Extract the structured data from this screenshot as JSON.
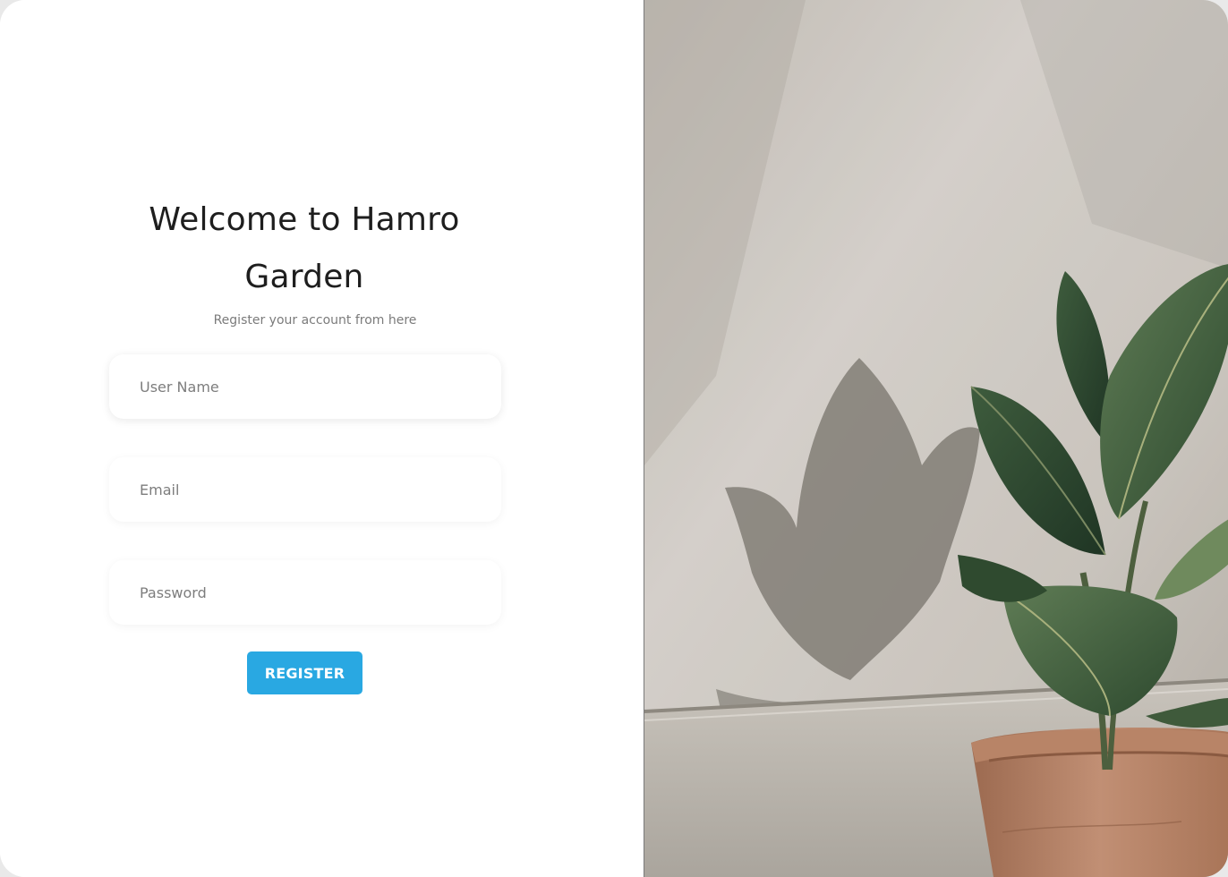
{
  "header": {
    "title": "Welcome to Hamro Garden",
    "subtitle": "Register your account from here"
  },
  "form": {
    "username": {
      "placeholder": "User Name",
      "value": ""
    },
    "email": {
      "placeholder": "Email",
      "value": ""
    },
    "password": {
      "placeholder": "Password",
      "value": ""
    },
    "submit_label": "REGISTER"
  },
  "colors": {
    "accent": "#29a8e2",
    "title_text": "#1e1e1e",
    "subtitle_text": "#7b7b7b"
  },
  "image": {
    "icon": "potted-plant-photo"
  }
}
